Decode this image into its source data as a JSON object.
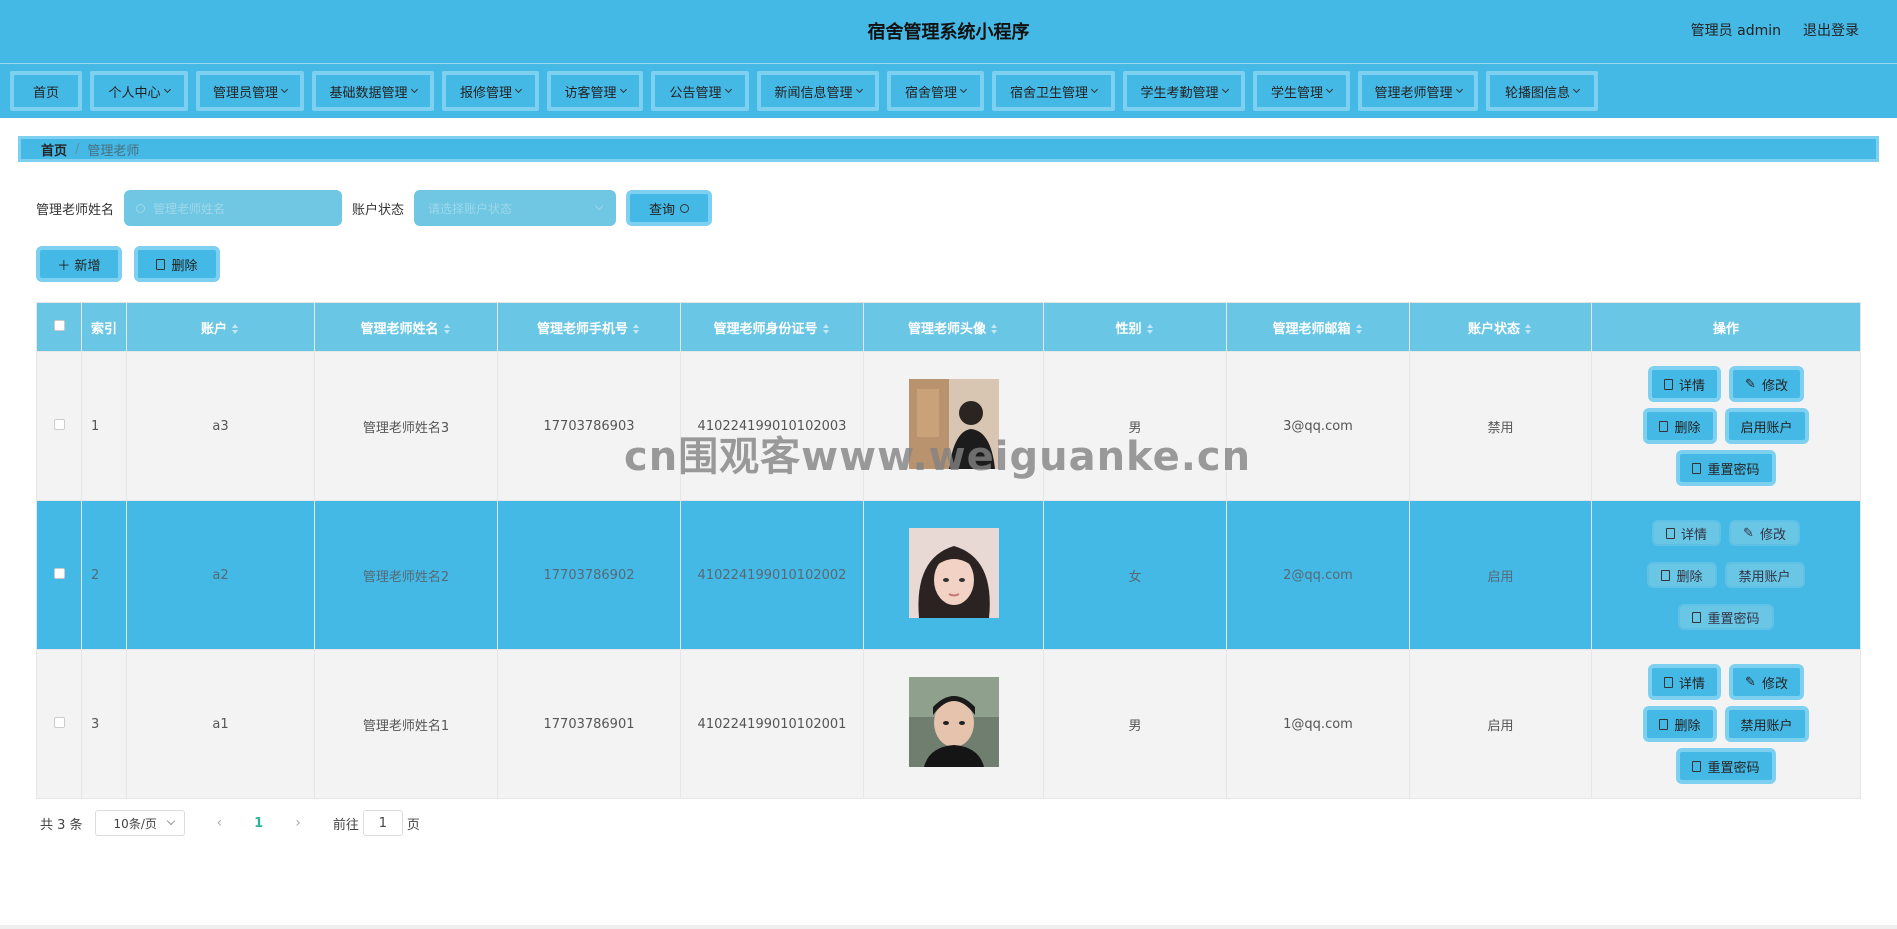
{
  "header": {
    "title": "宿舍管理系统小程序",
    "user_label": "管理员 admin",
    "logout": "退出登录"
  },
  "nav": {
    "items": [
      {
        "label": "首页",
        "dropdown": false
      },
      {
        "label": "个人中心",
        "dropdown": true
      },
      {
        "label": "管理员管理",
        "dropdown": true
      },
      {
        "label": "基础数据管理",
        "dropdown": true
      },
      {
        "label": "报修管理",
        "dropdown": true
      },
      {
        "label": "访客管理",
        "dropdown": true
      },
      {
        "label": "公告管理",
        "dropdown": true
      },
      {
        "label": "新闻信息管理",
        "dropdown": true
      },
      {
        "label": "宿舍管理",
        "dropdown": true
      },
      {
        "label": "宿舍卫生管理",
        "dropdown": true
      },
      {
        "label": "学生考勤管理",
        "dropdown": true
      },
      {
        "label": "学生管理",
        "dropdown": true
      },
      {
        "label": "管理老师管理",
        "dropdown": true
      },
      {
        "label": "轮播图信息",
        "dropdown": true
      }
    ]
  },
  "breadcrumb": {
    "home": "首页",
    "sep": "/",
    "current": "管理老师"
  },
  "search": {
    "name_label": "管理老师姓名",
    "name_placeholder": "管理老师姓名",
    "status_label": "账户状态",
    "status_placeholder": "请选择账户状态",
    "query_button": "查询"
  },
  "actions": {
    "add": "＋ 新增",
    "delete": "删除"
  },
  "table": {
    "columns": [
      "索引",
      "账户",
      "管理老师姓名",
      "管理老师手机号",
      "管理老师身份证号",
      "管理老师头像",
      "性别",
      "管理老师邮箱",
      "账户状态",
      "操作"
    ],
    "rows": [
      {
        "index": "1",
        "account": "a3",
        "name": "管理老师姓名3",
        "phone": "17703786903",
        "id_number": "410224199010102003",
        "gender": "男",
        "email": "3@qq.com",
        "status": "禁用",
        "toggle": "启用账户",
        "selected": false
      },
      {
        "index": "2",
        "account": "a2",
        "name": "管理老师姓名2",
        "phone": "17703786902",
        "id_number": "410224199010102002",
        "gender": "女",
        "email": "2@qq.com",
        "status": "启用",
        "toggle": "禁用账户",
        "selected": true
      },
      {
        "index": "3",
        "account": "a1",
        "name": "管理老师姓名1",
        "phone": "17703786901",
        "id_number": "410224199010102001",
        "gender": "男",
        "email": "1@qq.com",
        "status": "启用",
        "toggle": "禁用账户",
        "selected": false
      }
    ],
    "op_labels": {
      "detail": "详情",
      "edit": "修改",
      "delete": "删除",
      "reset": "重置密码"
    }
  },
  "pager": {
    "total": "共 3 条",
    "page_size": "10条/页",
    "current_page": "1",
    "goto_prefix": "前往",
    "goto_value": "1",
    "goto_suffix": "页"
  },
  "watermark": "cn围观客www.weiguanke.cn",
  "colors": {
    "primary": "#44b9e6",
    "border_accent": "#7dd0f0",
    "table_header": "#6ac6e5"
  }
}
